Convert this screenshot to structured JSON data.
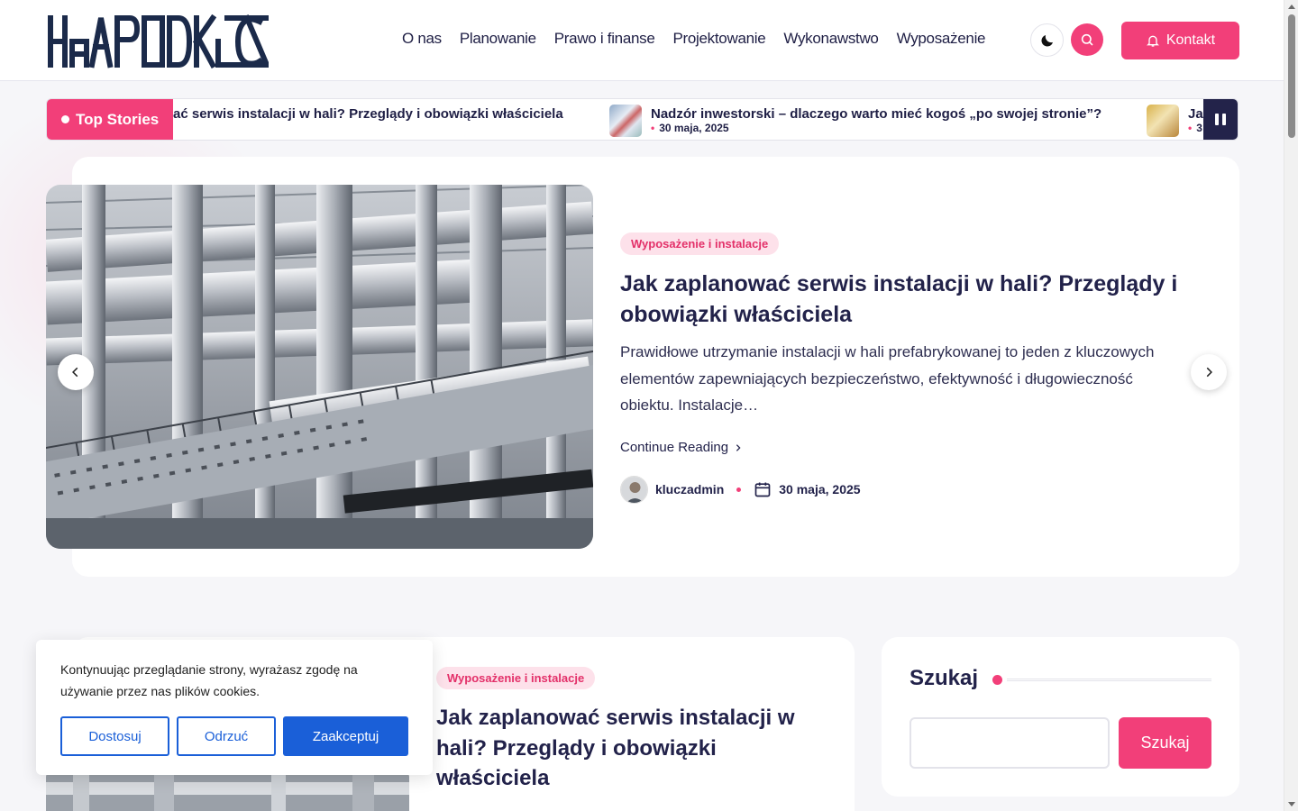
{
  "brand": {
    "name": "HALAPODKLUCZ",
    "accent": "#f23f79",
    "navy": "#1b2a4a"
  },
  "nav": {
    "items": [
      "O nas",
      "Planowanie",
      "Prawo i finanse",
      "Projektowanie",
      "Wykonawstwo",
      "Wyposażenie"
    ]
  },
  "header": {
    "contact_label": "Kontakt",
    "dark_mode_icon": "moon-icon",
    "search_icon": "search-icon"
  },
  "ticker": {
    "label": "Top Stories",
    "items": [
      {
        "title": "Jak zaplanować serwis instalacji w hali? Przeglądy i obowiązki właściciela",
        "visible_title": "ać serwis instalacji w hali? Przeglądy i obowiązki właściciela"
      },
      {
        "title": "Nadzór inwestorski – dlaczego warto mieć kogoś „po swojej stronie”?",
        "date": "30 maja, 2025"
      },
      {
        "title": "Ja",
        "date": "3"
      }
    ]
  },
  "hero": {
    "category": "Wyposażenie i instalacje",
    "title": "Jak zaplanować serwis instalacji w hali? Przeglądy i obowiązki właściciela",
    "excerpt": "Prawidłowe utrzymanie instalacji w hali prefabrykowanej to jeden z kluczowych elementów zapewniających bezpieczeństwo, efektywność i długowieczność obiektu. Instalacje…",
    "read_more": "Continue Reading",
    "author": "kluczadmin",
    "date": "30 maja, 2025"
  },
  "post": {
    "category": "Wyposażenie i instalacje",
    "title": "Jak zaplanować serwis instalacji w hali? Przeglądy i obowiązki właściciela"
  },
  "sidebar": {
    "search_title": "Szukaj",
    "search_button": "Szukaj",
    "search_value": ""
  },
  "cookie": {
    "text": "Kontynuując przeglądanie strony, wyrażasz zgodę na używanie przez nas plików cookies.",
    "customize": "Dostosuj",
    "reject": "Odrzuć",
    "accept": "Zaakceptuj"
  }
}
